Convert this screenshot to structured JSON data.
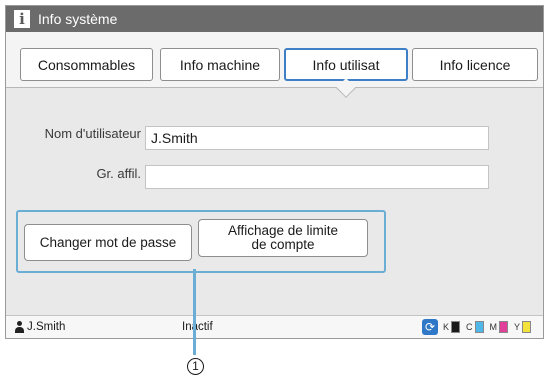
{
  "window": {
    "title": "Info système",
    "title_icon": "info-icon"
  },
  "tabs": [
    {
      "label": "Consommables",
      "active": false
    },
    {
      "label": "Info machine",
      "active": false
    },
    {
      "label": "Info utilisat",
      "active": true
    },
    {
      "label": "Info licence",
      "active": false
    }
  ],
  "form": {
    "user_name_label": "Nom d'utilisateur",
    "user_name_value": "J.Smith",
    "group_label": "Gr. affil.",
    "group_value": ""
  },
  "actions": {
    "change_password": "Changer mot de passe",
    "account_limit_line1": "Affichage de limite",
    "account_limit_line2": "de compte"
  },
  "status_bar": {
    "user": "J.Smith",
    "status": "Inactif",
    "ink": [
      {
        "label": "K",
        "color": "#1a1a1a"
      },
      {
        "label": "C",
        "color": "#4fb8e8"
      },
      {
        "label": "M",
        "color": "#e0409a"
      },
      {
        "label": "Y",
        "color": "#f2e23a"
      }
    ]
  },
  "callout_number": "1",
  "colors": {
    "accent": "#3f7fc6",
    "highlight": "#6aaed6",
    "titlebar": "#6b6b6b"
  }
}
